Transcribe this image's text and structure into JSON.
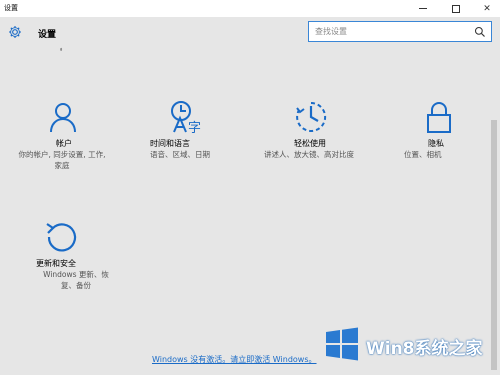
{
  "window": {
    "title": "设置",
    "controls": {
      "minimize_icon": "minimize-icon",
      "maximize_icon": "maximize-icon",
      "close_icon": "close-icon",
      "close_glyph": "✕"
    }
  },
  "header": {
    "title": "设置",
    "subtitle": "ಕ"
  },
  "search": {
    "placeholder": "查找设置",
    "value": "",
    "icon": "search-icon"
  },
  "tiles": [
    {
      "label": "帐户",
      "desc": "你的帐户, 同步设置, 工作, 家庭",
      "icon": "person-icon"
    },
    {
      "label": "时间和语言",
      "desc": "语音、区域、日期",
      "icon": "time-language-icon"
    },
    {
      "label": "轻松使用",
      "desc": "讲述人、放大镜、高对比度",
      "icon": "ease-of-access-icon"
    },
    {
      "label": "隐私",
      "desc": "位置、相机",
      "icon": "lock-icon"
    },
    {
      "label": "更新和安全",
      "desc": "Windows 更新、恢复、备份",
      "icon": "update-icon"
    }
  ],
  "activation_link": "Windows 没有激活。请立即激活 Windows。",
  "watermark": {
    "text": "Win8系统之家",
    "logo": "windows-logo-icon"
  },
  "colors": {
    "accent": "#1a6bc7",
    "background": "#e6e6e6"
  }
}
